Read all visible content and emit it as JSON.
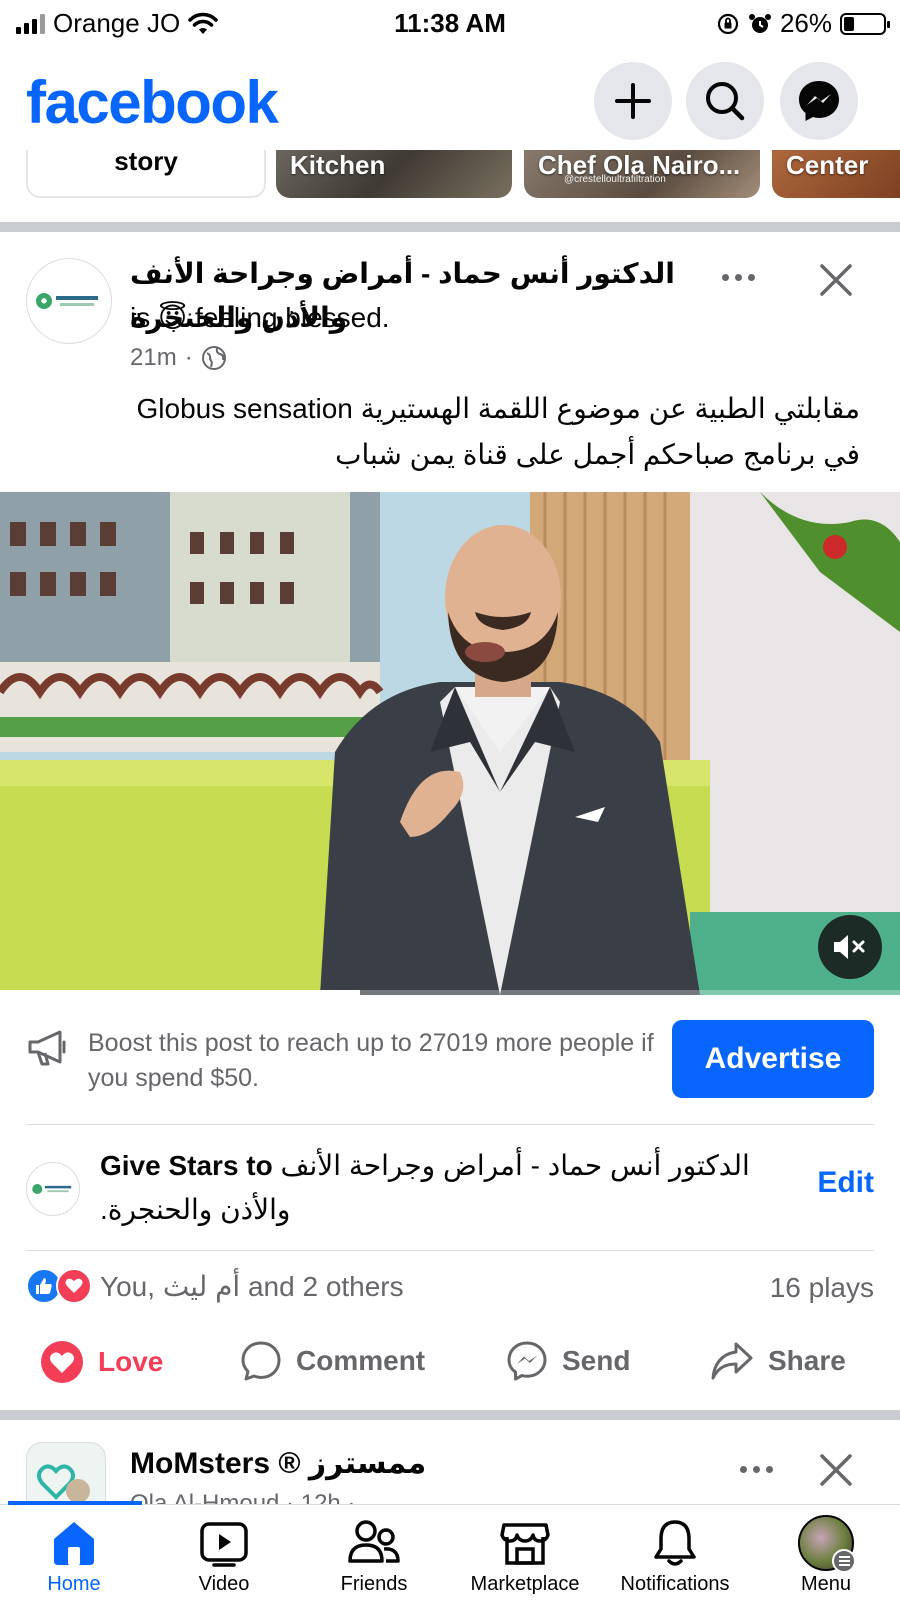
{
  "status_bar": {
    "carrier": "Orange JO",
    "time": "11:38 AM",
    "battery_percent": "26%",
    "battery_level": 0.26
  },
  "header": {
    "logo": "facebook",
    "icons": [
      "plus-icon",
      "search-icon",
      "messenger-icon"
    ]
  },
  "stories": [
    {
      "label": "story",
      "kind": "create"
    },
    {
      "label": "Kitchen",
      "kind": "story"
    },
    {
      "label": "Chef Ola Nairo...",
      "kind": "story",
      "watermark": "@crestelloultrafiltration"
    },
    {
      "label": "Center",
      "kind": "story"
    }
  ],
  "post": {
    "author": "الدكتور أنس حماد - أمراض وجراحة الأنف والأذن والحنجرة",
    "feeling_prefix": "is",
    "feeling_emoji": "😇",
    "feeling": "feeling blessed.",
    "time": "21m",
    "audience_icon": "globe-icon",
    "avatar_text": "Dr.ANAS HAMMAD ENT CLINIC",
    "text_line1": "مقابلتي الطبية عن موضوع اللقمة الهستيرية Globus sensation",
    "text_line2": "في برنامج صباحكم أجمل على قناة يمن شباب",
    "video_progress": 0.4,
    "boost_text": "Boost this post to reach up to 27019 more people if you spend $50.",
    "advertise_label": "Advertise",
    "stars_prefix": "Give Stars to",
    "stars_name": "الدكتور أنس حماد - أمراض وجراحة الأنف والأذن والحنجرة.",
    "edit_label": "Edit",
    "reactions_text": "You, أم ليث and 2 others",
    "plays": "16 plays",
    "actions": {
      "love": "Love",
      "comment": "Comment",
      "send": "Send",
      "share": "Share"
    }
  },
  "next_post": {
    "author": "MoMsters ® ممسترز",
    "meta": "Ola Al-Hmoud · 12h ·"
  },
  "tabs": [
    {
      "label": "Home",
      "active": true
    },
    {
      "label": "Video",
      "active": false
    },
    {
      "label": "Friends",
      "active": false
    },
    {
      "label": "Marketplace",
      "active": false
    },
    {
      "label": "Notifications",
      "active": false
    },
    {
      "label": "Menu",
      "active": false
    }
  ],
  "colors": {
    "brand": "#0866ff",
    "love": "#f33e58",
    "secondary_text": "#65676b",
    "divider": "#c9ccd1"
  }
}
